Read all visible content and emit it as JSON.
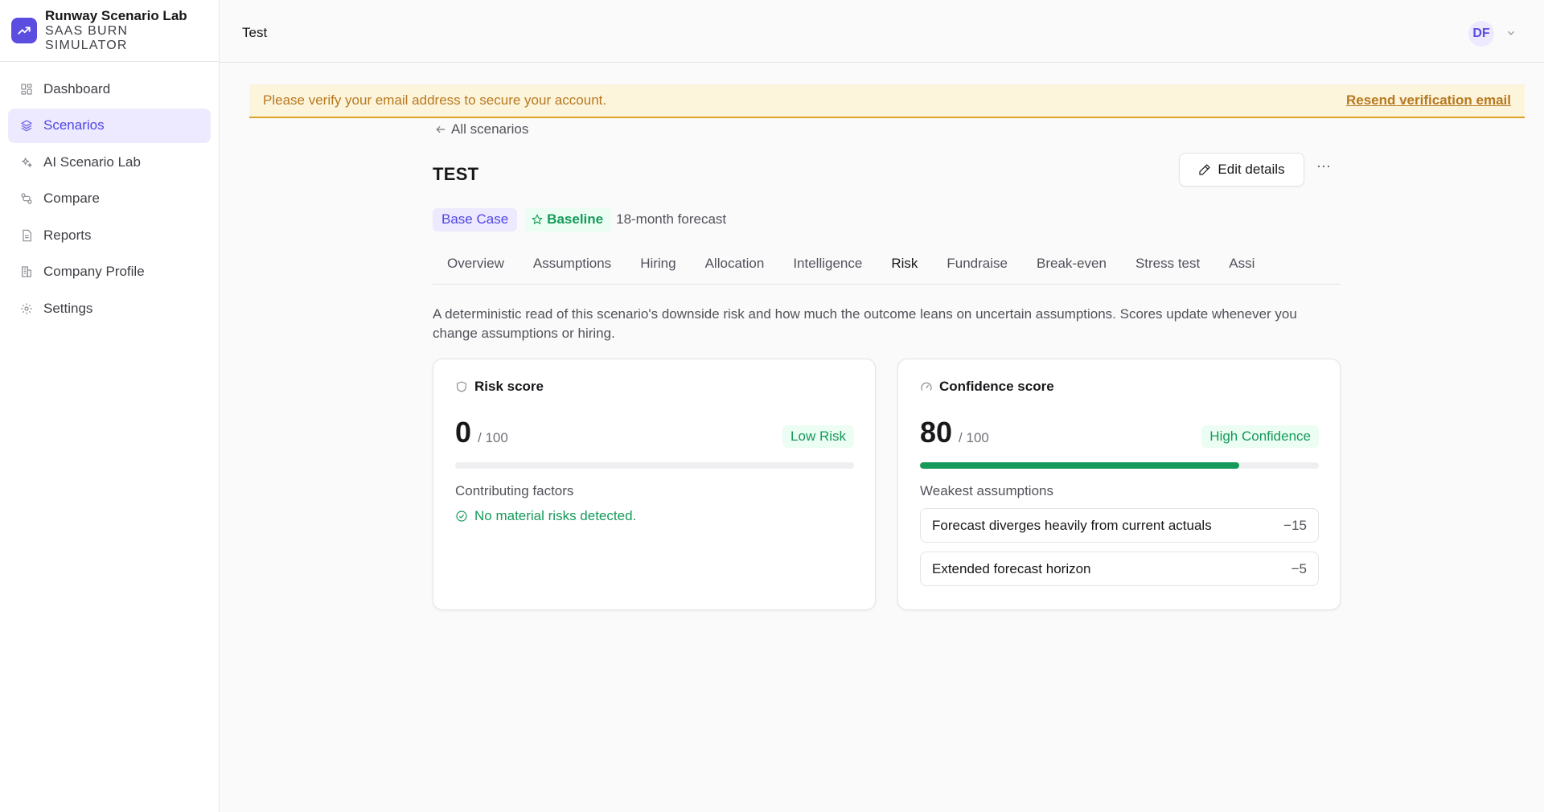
{
  "app": {
    "title": "Runway Scenario Lab",
    "subtitle": "SAAS BURN SIMULATOR"
  },
  "sidebar": {
    "items": [
      {
        "label": "Dashboard",
        "icon": "dashboard-icon",
        "active": false
      },
      {
        "label": "Scenarios",
        "icon": "layers-icon",
        "active": true
      },
      {
        "label": "AI Scenario Lab",
        "icon": "sparkles-icon",
        "active": false
      },
      {
        "label": "Compare",
        "icon": "compare-icon",
        "active": false
      },
      {
        "label": "Reports",
        "icon": "report-icon",
        "active": false
      },
      {
        "label": "Company Profile",
        "icon": "building-icon",
        "active": false
      },
      {
        "label": "Settings",
        "icon": "gear-icon",
        "active": false
      }
    ]
  },
  "header": {
    "title": "Test",
    "avatar_initials": "DF"
  },
  "banner": {
    "text": "Please verify your email address to secure your account.",
    "link": "Resend verification email"
  },
  "scenario": {
    "back_label": "All scenarios",
    "title": "TEST",
    "edit_label": "Edit details",
    "more_label": "···",
    "tag_case": "Base Case",
    "tag_baseline": "Baseline",
    "forecast": "18-month forecast"
  },
  "tabs": [
    {
      "label": "Overview",
      "active": false
    },
    {
      "label": "Assumptions",
      "active": false
    },
    {
      "label": "Hiring",
      "active": false
    },
    {
      "label": "Allocation",
      "active": false
    },
    {
      "label": "Intelligence",
      "active": false
    },
    {
      "label": "Risk",
      "active": true
    },
    {
      "label": "Fundraise",
      "active": false
    },
    {
      "label": "Break-even",
      "active": false
    },
    {
      "label": "Stress test",
      "active": false
    },
    {
      "label": "Assi",
      "active": false
    }
  ],
  "description": "A deterministic read of this scenario's downside risk and how much the outcome leans on uncertain assumptions. Scores update whenever you change assumptions or hiring.",
  "risk": {
    "heading": "Risk score",
    "score": "0",
    "out_of": "/ 100",
    "badge": "Low Risk",
    "progress": 0,
    "factors_label": "Contributing factors",
    "no_risks": "No material risks detected."
  },
  "confidence": {
    "heading": "Confidence score",
    "score": "80",
    "out_of": "/ 100",
    "badge": "High Confidence",
    "progress": 0.8,
    "weakest_label": "Weakest assumptions",
    "assumptions": [
      {
        "label": "Forecast diverges heavily from current actuals",
        "penalty": "−15"
      },
      {
        "label": "Extended forecast horizon",
        "penalty": "−5"
      }
    ]
  },
  "colors": {
    "accent": "#5b4de0",
    "success": "#159a5a",
    "warning": "#b7791f"
  }
}
